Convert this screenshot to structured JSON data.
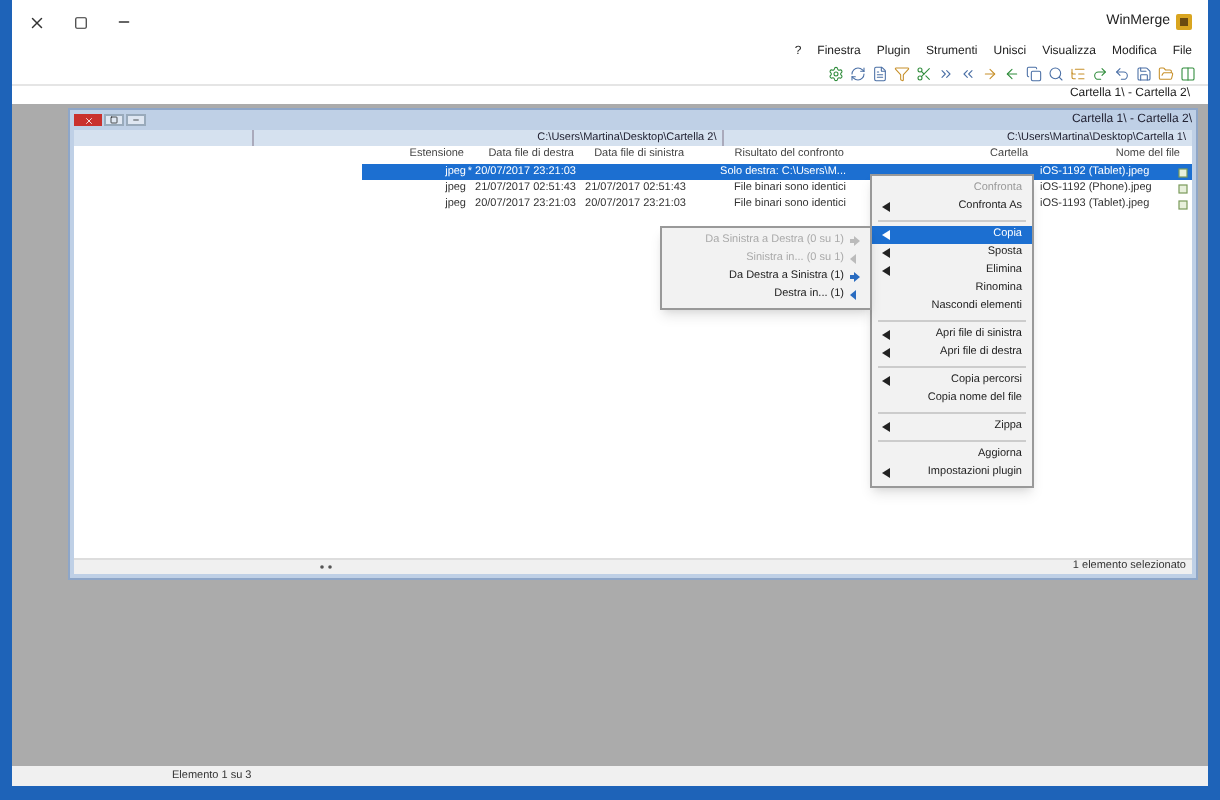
{
  "window": {
    "title": "WinMerge"
  },
  "menu": [
    "?",
    "Finestra",
    "Plugin",
    "Strumenti",
    "Unisci",
    "Visualizza",
    "Modifica",
    "File"
  ],
  "tab": {
    "label": "Cartella 1\\ - Cartella 2\\",
    "selected": true
  },
  "child": {
    "title": "Cartella 1\\ - Cartella 2\\",
    "paths": [
      "C:\\Users\\Martina\\Desktop\\Cartella 2\\",
      "C:\\Users\\Martina\\Desktop\\Cartella 1\\"
    ],
    "columns": [
      "Estensione",
      "Data file di destra",
      "Data file di sinistra",
      "Risultato del confronto",
      "Cartella",
      "Nome del file"
    ],
    "rows": [
      {
        "selected": true,
        "cells": [
          "jpeg",
          "* 20/07/2017 23:21:03",
          "",
          "Solo destra: C:\\Users\\M...",
          "",
          "iOS-1192 (Tablet).jpeg"
        ]
      },
      {
        "selected": false,
        "cells": [
          "jpeg",
          "21/07/2017 02:51:43",
          "21/07/2017 02:51:43",
          "File binari sono identici",
          "",
          "iOS-1192 (Phone).jpeg"
        ]
      },
      {
        "selected": false,
        "cells": [
          "jpeg",
          "20/07/2017 23:21:03",
          "20/07/2017 23:21:03",
          "File binari sono identici",
          "",
          "iOS-1193 (Tablet).jpeg"
        ]
      }
    ],
    "status": "1 elemento selezionato"
  },
  "context_menu": [
    {
      "kind": "item",
      "label": "Confronta",
      "disabled": true,
      "submenu": false,
      "selected": false
    },
    {
      "kind": "item",
      "label": "Confronta As",
      "disabled": false,
      "submenu": true,
      "selected": false
    },
    {
      "kind": "separator"
    },
    {
      "kind": "item",
      "label": "Copia",
      "disabled": false,
      "submenu": true,
      "selected": true
    },
    {
      "kind": "item",
      "label": "Sposta",
      "disabled": false,
      "submenu": true,
      "selected": false
    },
    {
      "kind": "item",
      "label": "Elimina",
      "disabled": false,
      "submenu": true,
      "selected": false
    },
    {
      "kind": "item",
      "label": "Rinomina",
      "disabled": false,
      "submenu": false,
      "selected": false
    },
    {
      "kind": "item",
      "label": "Nascondi elementi",
      "disabled": false,
      "submenu": false,
      "selected": false
    },
    {
      "kind": "separator"
    },
    {
      "kind": "item",
      "label": "Apri file di sinistra",
      "disabled": false,
      "submenu": true,
      "selected": false
    },
    {
      "kind": "item",
      "label": "Apri file di destra",
      "disabled": false,
      "submenu": true,
      "selected": false
    },
    {
      "kind": "separator"
    },
    {
      "kind": "item",
      "label": "Copia percorsi",
      "disabled": false,
      "submenu": true,
      "selected": false
    },
    {
      "kind": "item",
      "label": "Copia nome del file",
      "disabled": false,
      "submenu": false,
      "selected": false
    },
    {
      "kind": "separator"
    },
    {
      "kind": "item",
      "label": "Zippa",
      "disabled": false,
      "submenu": true,
      "selected": false
    },
    {
      "kind": "separator"
    },
    {
      "kind": "item",
      "label": "Aggiorna",
      "disabled": false,
      "submenu": false,
      "selected": false
    },
    {
      "kind": "item",
      "label": "Impostazioni plugin",
      "disabled": false,
      "submenu": true,
      "selected": false
    }
  ],
  "submenu": [
    {
      "label": "Da Sinistra a Destra (0 su 1)",
      "disabled": true
    },
    {
      "label": "Sinistra in... (0 su 1)",
      "disabled": true
    },
    {
      "label": "Da Destra a Sinistra (1)",
      "disabled": false
    },
    {
      "label": "Destra in... (1)",
      "disabled": false
    }
  ],
  "status_bar": "Elemento 1 su 3"
}
